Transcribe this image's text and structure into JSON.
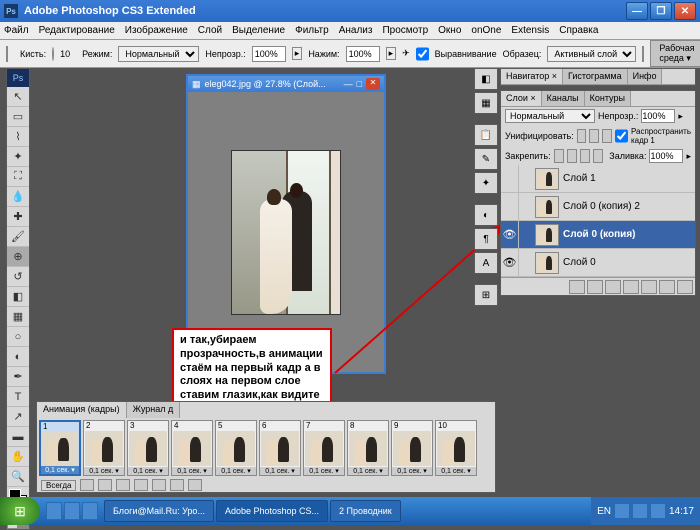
{
  "title": "Adobe Photoshop CS3 Extended",
  "menu": [
    "Файл",
    "Редактирование",
    "Изображение",
    "Слой",
    "Выделение",
    "Фильтр",
    "Анализ",
    "Просмотр",
    "Окно",
    "onOne",
    "Extensis",
    "Справка"
  ],
  "options": {
    "brush_label": "Кисть:",
    "brush_size": "10",
    "mode_label": "Режим:",
    "mode": "Нормальный",
    "opacity_label": "Непрозр.:",
    "opacity": "100%",
    "flow_label": "Нажим:",
    "flow": "100%",
    "align_label": "Выравнивание",
    "sample_label": "Образец:",
    "sample": "Активный слой",
    "workspace": "Рабочая среда ▾"
  },
  "doc": {
    "title": "eleg042.jpg @ 27.8% (Слой..."
  },
  "annotation": "и так,убираем прозрачность,в анимации стаём на первый кадр а в слоях на первом слое ставим глазик,как видите у нас прозрачность кадров исчезла",
  "animation": {
    "tab1": "Анимация (кадры)",
    "tab2": "Журнал д",
    "frames": [
      1,
      2,
      3,
      4,
      5,
      6,
      7,
      8,
      9,
      10
    ],
    "delay": "0,1 сек.",
    "loop": "Всегда"
  },
  "nav_tabs": [
    "Навигатор ×",
    "Гистограмма",
    "Инфо"
  ],
  "layer_tabs": [
    "Слои ×",
    "Каналы",
    "Контуры"
  ],
  "layer_panel": {
    "mode": "Нормальный",
    "opacity_l": "Непрозр.:",
    "opacity": "100%",
    "unify": "Унифицировать:",
    "propagate": "Распространить кадр 1",
    "lock": "Закрепить:",
    "fill_l": "Заливка:",
    "fill": "100%"
  },
  "layers": [
    {
      "name": "Слой 1",
      "vis": false,
      "sel": false
    },
    {
      "name": "Слой 0 (копия) 2",
      "vis": false,
      "sel": false
    },
    {
      "name": "Слой 0 (копия)",
      "vis": true,
      "sel": true
    },
    {
      "name": "Слой 0",
      "vis": true,
      "sel": false
    }
  ],
  "taskbar": {
    "t1": "Блоги@Mail.Ru: Уро...",
    "t2": "Adobe Photoshop CS...",
    "t3": "2 Проводник",
    "lang": "EN",
    "clock": "14:17"
  }
}
